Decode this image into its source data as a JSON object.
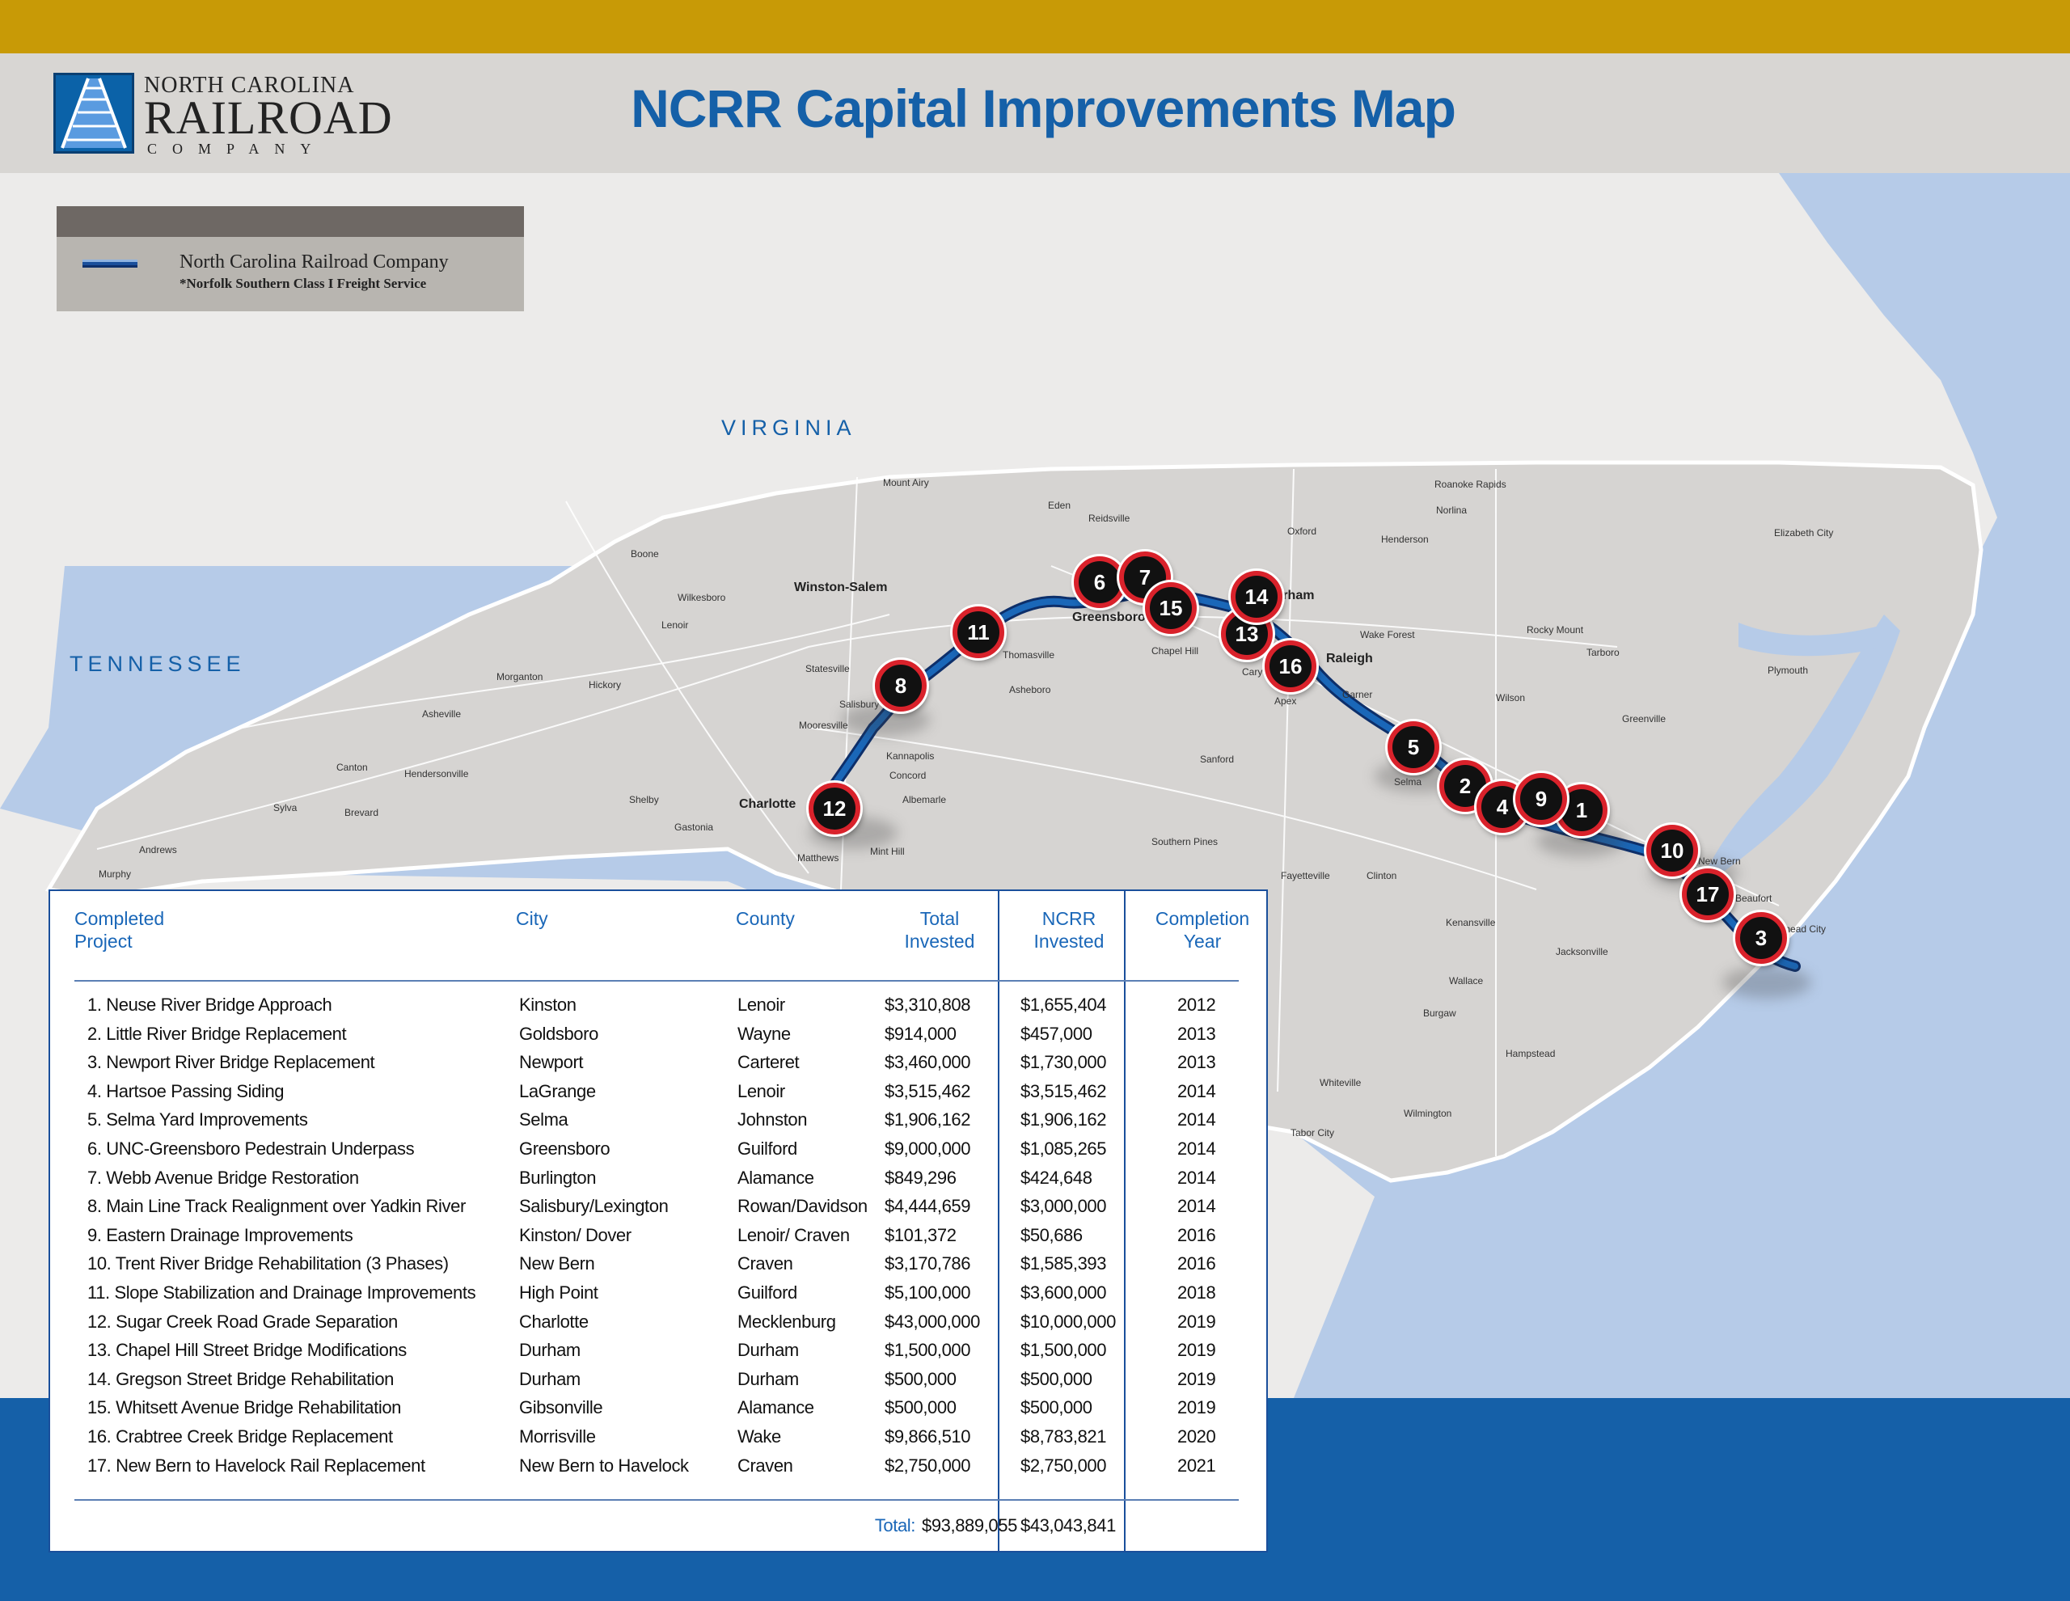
{
  "header": {
    "logo": {
      "line1": "NORTH CAROLINA",
      "line2": "RAILROAD",
      "line3": "COMPANY"
    },
    "title": "NCRR Capital Improvements Map"
  },
  "legend": {
    "line_name": "North Carolina Railroad Company",
    "line_note": "*Norfolk Southern Class I Freight Service",
    "line_color": "#1a4f9b"
  },
  "map": {
    "state_labels": [
      "VIRGINIA",
      "TENNESSEE"
    ],
    "cities": [
      "Winston-Salem",
      "Greensboro",
      "Charlotte",
      "Raleigh",
      "Cary",
      "Durham",
      "Chapel Hill",
      "Salisbury",
      "Concord",
      "Kannapolis",
      "Thomasville",
      "Asheboro",
      "Gastonia",
      "Asheville",
      "Hickory",
      "Statesville",
      "Mooresville",
      "Matthews",
      "Mint Hill",
      "Fayetteville",
      "Jacksonville",
      "Wilmington",
      "Greenville",
      "New Bern",
      "Rocky Mount",
      "Wilson",
      "Garner",
      "Apex",
      "Selma",
      "Morganton",
      "Boone",
      "Wilkesboro",
      "Mount Airy",
      "Reidsville",
      "Eden",
      "Henderson",
      "Wake Forest",
      "Tarboro",
      "Elizabeth City",
      "Plymouth",
      "Beaufort",
      "Morehead City",
      "Sanford",
      "Southern Pines",
      "Albemarle",
      "Shelby",
      "Lenoir",
      "Hendersonville",
      "Brevard",
      "Sylva",
      "Murphy",
      "Andrews",
      "Canton",
      "Whiteville",
      "Tabor City",
      "Oxford",
      "Roanoke Rapids",
      "Norlina",
      "Clinton",
      "Kenansville",
      "Wallace",
      "Burgaw",
      "Hampstead"
    ],
    "markers": [
      {
        "num": "1",
        "label": "Kinston"
      },
      {
        "num": "2",
        "label": "Goldsboro"
      },
      {
        "num": "3",
        "label": "Newport"
      },
      {
        "num": "4",
        "label": "LaGrange"
      },
      {
        "num": "5",
        "label": "Selma"
      },
      {
        "num": "6",
        "label": "Greensboro"
      },
      {
        "num": "7",
        "label": "Burlington"
      },
      {
        "num": "8",
        "label": "Salisbury/Lexington"
      },
      {
        "num": "9",
        "label": "Kinston/ Dover"
      },
      {
        "num": "10",
        "label": "New Bern"
      },
      {
        "num": "11",
        "label": "High Point"
      },
      {
        "num": "12",
        "label": "Charlotte"
      },
      {
        "num": "13",
        "label": "Durham"
      },
      {
        "num": "14",
        "label": "Durham"
      },
      {
        "num": "15",
        "label": "Gibsonville"
      },
      {
        "num": "16",
        "label": "Morrisville"
      },
      {
        "num": "17",
        "label": "New Bern to Havelock"
      }
    ],
    "colors": {
      "land_nc": "#d6d4d2",
      "land_other": "#ecebea",
      "water": "#b6cbe8",
      "marker_ring": "#d9222b"
    }
  },
  "table": {
    "headers": {
      "project": [
        "Completed",
        "Project"
      ],
      "city": "City",
      "county": "County",
      "total": [
        "Total",
        "Invested"
      ],
      "ncrr": [
        "NCRR",
        "Invested"
      ],
      "year": [
        "Completion",
        "Year"
      ]
    },
    "rows": [
      {
        "project": "1.  Neuse River Bridge Approach",
        "city": "Kinston",
        "county": "Lenoir",
        "total": "$3,310,808",
        "ncrr": "$1,655,404",
        "year": "2012"
      },
      {
        "project": "2.  Little River Bridge Replacement",
        "city": "Goldsboro",
        "county": "Wayne",
        "total": "$914,000",
        "ncrr": "$457,000",
        "year": "2013"
      },
      {
        "project": "3.  Newport River Bridge Replacement",
        "city": "Newport",
        "county": "Carteret",
        "total": "$3,460,000",
        "ncrr": "$1,730,000",
        "year": "2013"
      },
      {
        "project": "4.  Hartsoe Passing Siding",
        "city": "LaGrange",
        "county": "Lenoir",
        "total": "$3,515,462",
        "ncrr": "$3,515,462",
        "year": "2014"
      },
      {
        "project": "5.  Selma Yard Improvements",
        "city": "Selma",
        "county": "Johnston",
        "total": "$1,906,162",
        "ncrr": "$1,906,162",
        "year": "2014"
      },
      {
        "project": "6.  UNC-Greensboro Pedestrain Underpass",
        "city": "Greensboro",
        "county": "Guilford",
        "total": "$9,000,000",
        "ncrr": "$1,085,265",
        "year": "2014"
      },
      {
        "project": "7.  Webb Avenue Bridge Restoration",
        "city": "Burlington",
        "county": "Alamance",
        "total": "$849,296",
        "ncrr": "$424,648",
        "year": "2014"
      },
      {
        "project": "8.  Main Line Track Realignment over Yadkin River",
        "city": "Salisbury/Lexington",
        "county": "Rowan/Davidson",
        "total": "$4,444,659",
        "ncrr": "$3,000,000",
        "year": "2014"
      },
      {
        "project": "9.  Eastern Drainage Improvements",
        "city": "Kinston/ Dover",
        "county": "Lenoir/ Craven",
        "total": "$101,372",
        "ncrr": "$50,686",
        "year": "2016"
      },
      {
        "project": "10. Trent River Bridge Rehabilitation (3 Phases)",
        "city": "New Bern",
        "county": "Craven",
        "total": "$3,170,786",
        "ncrr": "$1,585,393",
        "year": "2016"
      },
      {
        "project": "11. Slope Stabilization and Drainage Improvements",
        "city": "High Point",
        "county": "Guilford",
        "total": "$5,100,000",
        "ncrr": "$3,600,000",
        "year": "2018"
      },
      {
        "project": "12. Sugar Creek Road Grade Separation",
        "city": "Charlotte",
        "county": "Mecklenburg",
        "total": "$43,000,000",
        "ncrr": "$10,000,000",
        "year": "2019"
      },
      {
        "project": "13. Chapel Hill Street Bridge Modifications",
        "city": "Durham",
        "county": "Durham",
        "total": "$1,500,000",
        "ncrr": "$1,500,000",
        "year": "2019"
      },
      {
        "project": "14. Gregson Street Bridge Rehabilitation",
        "city": "Durham",
        "county": "Durham",
        "total": "$500,000",
        "ncrr": "$500,000",
        "year": "2019"
      },
      {
        "project": "15. Whitsett Avenue Bridge Rehabilitation",
        "city": "Gibsonville",
        "county": "Alamance",
        "total": "$500,000",
        "ncrr": "$500,000",
        "year": "2019"
      },
      {
        "project": "16. Crabtree Creek Bridge Replacement",
        "city": "Morrisville",
        "county": "Wake",
        "total": "$9,866,510",
        "ncrr": "$8,783,821",
        "year": "2020"
      },
      {
        "project": "17. New Bern to Havelock Rail Replacement",
        "city": "New Bern to Havelock",
        "county": "Craven",
        "total": "$2,750,000",
        "ncrr": "$2,750,000",
        "year": "2021"
      }
    ],
    "totals": {
      "label": "Total:",
      "total": "$93,889,055",
      "ncrr": "$43,043,841"
    }
  }
}
